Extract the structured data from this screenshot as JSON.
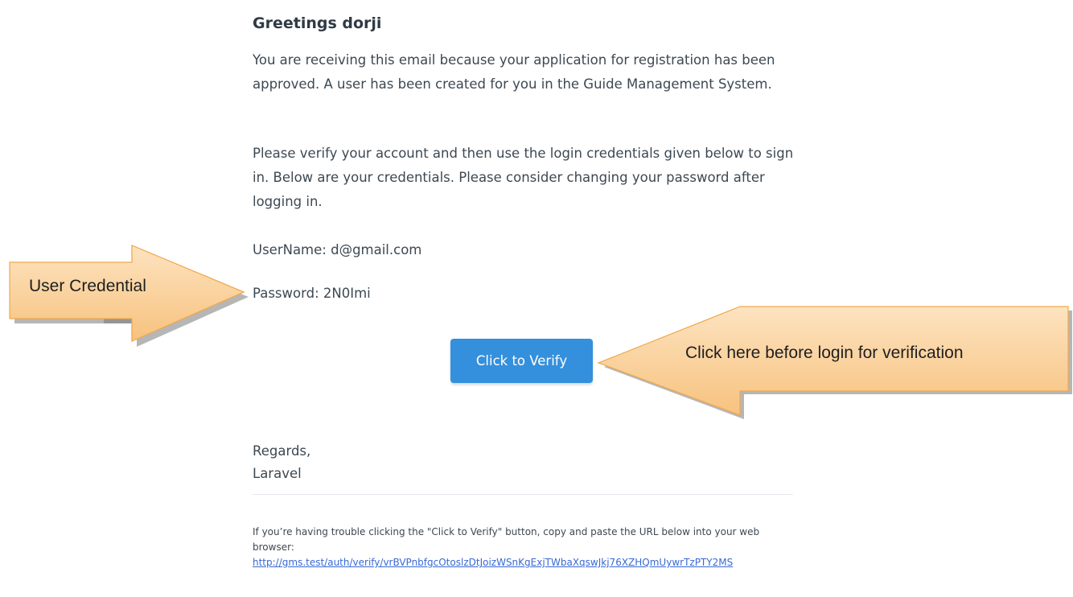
{
  "email": {
    "greeting": "Greetings dorji",
    "paragraph_1": "You are receiving this email because your application for registration has been approved. A user has been created for you in the Guide Management System.",
    "paragraph_2": "Please verify your account and then use the login credentials given below to sign in. Below are your credentials. Please consider changing your password after logging in.",
    "username_line": "UserName: d@gmail.com",
    "password_line": "Password: 2N0Imi",
    "verify_button_label": "Click to Verify",
    "regards": "Regards,",
    "sender": "Laravel",
    "subcopy_text": "If you’re having trouble clicking the \"Click to Verify\" button, copy and paste the URL below into your web browser:",
    "verify_url": "http://gms.test/auth/verify/vrBVPnbfgcOtoslzDtJoizWSnKgExjTWbaXqswJkj76XZHQmUywrTzPTY2MS"
  },
  "annotations": {
    "left_callout": "User Credential",
    "right_callout": "Click here before login for verification",
    "callout_fill": "#f8cc90",
    "callout_stroke": "#f0a94c"
  }
}
